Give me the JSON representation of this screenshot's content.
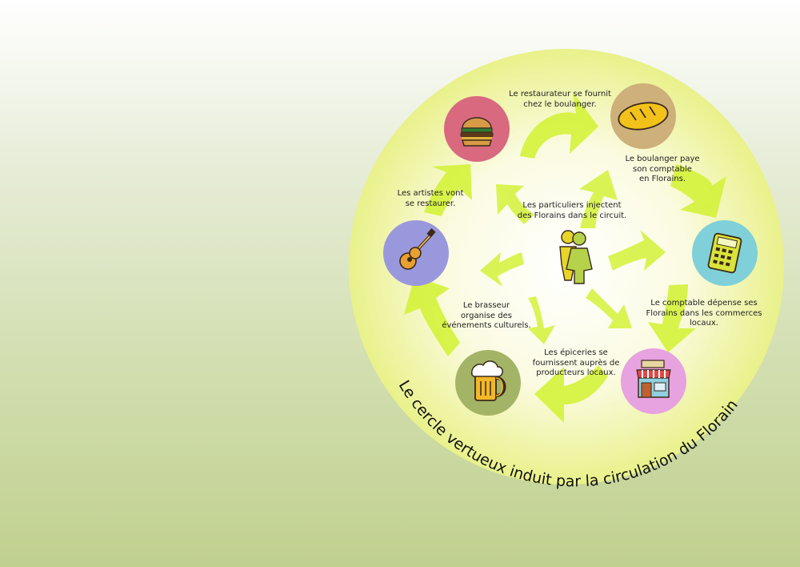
{
  "title": "Le cercle vertueux induit par la circulation du Florain",
  "center_text": "Les particuliers injectent\ndes Florains dans le circuit.",
  "nodes": [
    {
      "name": "restaurateur",
      "icon": "burger-icon",
      "color": "#d9697f",
      "text": "Le restaurateur se fournit\nchez le boulanger."
    },
    {
      "name": "boulanger",
      "icon": "bread-icon",
      "color": "#cdb07a",
      "text": "Le boulanger paye\nson comptable\nen Florains."
    },
    {
      "name": "comptable",
      "icon": "calculator-icon",
      "color": "#7fd0d8",
      "text": "Le comptable dépense ses\nFlorains dans les commerces\nlocaux."
    },
    {
      "name": "epicerie",
      "icon": "shop-icon",
      "color": "#e7a2e0",
      "text": "Les épiceries se\nfournissent auprès de\nproducteurs locaux."
    },
    {
      "name": "brasseur",
      "icon": "beer-icon",
      "color": "#a4b466",
      "text": "Le brasseur\norganise des\névénements culturels."
    },
    {
      "name": "artistes",
      "icon": "guitar-icon",
      "color": "#9a98dc",
      "text": "Les artistes vont\nse restaurer."
    }
  ],
  "colors": {
    "arrow": "#d4f23a",
    "disc_center": "#ffffff",
    "disc_edge": "#e9f18a",
    "people_yellow": "#e9d52a",
    "people_green": "#b6d24a"
  }
}
